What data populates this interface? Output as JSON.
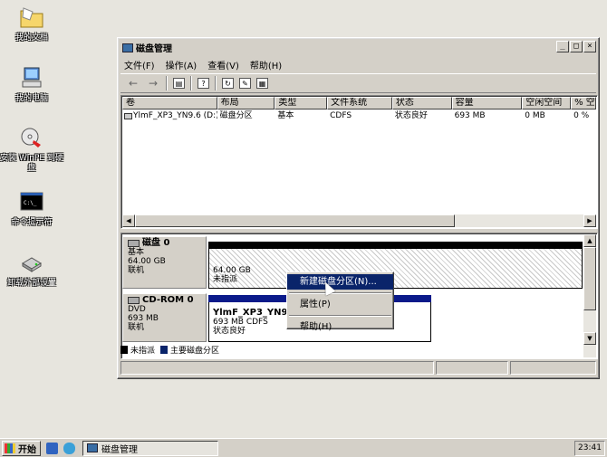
{
  "desktop": {
    "icons": [
      {
        "label": "我的文档",
        "icon": "folder-icon"
      },
      {
        "label": "我的电脑",
        "icon": "computer-icon"
      },
      {
        "label": "安装 WinPE 到硬盘",
        "icon": "install-disc-icon"
      },
      {
        "label": "命令提示符",
        "icon": "cmd-icon"
      },
      {
        "label": "卸载外部设置",
        "icon": "drive-icon"
      }
    ]
  },
  "window": {
    "title": "磁盘管理",
    "buttons": {
      "minimize": "_",
      "maximize": "□",
      "close": "×"
    },
    "menu": [
      "文件(F)",
      "操作(A)",
      "查看(V)",
      "帮助(H)"
    ],
    "toolbar": {
      "back": "←",
      "forward": "→",
      "t1": "▤",
      "t2": "?",
      "t3": "↻",
      "t4": "✎",
      "t5": "▦"
    }
  },
  "volume_list": {
    "columns": [
      "卷",
      "布局",
      "类型",
      "文件系统",
      "状态",
      "容量",
      "空闲空间",
      "% 空"
    ],
    "rows": [
      {
        "volume": "YlmF_XP3_YN9.6 (D:)",
        "layout": "磁盘分区",
        "type": "基本",
        "fs": "CDFS",
        "status": "状态良好",
        "capacity": "693 MB",
        "free": "0 MB",
        "pct": "0 %"
      }
    ]
  },
  "disks": [
    {
      "name": "磁盘 0",
      "type": "基本",
      "size": "64.00 GB",
      "state": "联机",
      "partition": {
        "size": "64.00 GB",
        "label": "未指派"
      }
    },
    {
      "name": "CD-ROM 0",
      "type": "DVD",
      "size": "693 MB",
      "state": "联机",
      "partition": {
        "name": "YlmF_XP3_YN9.6",
        "detail": "693 MB CDFS",
        "status": "状态良好"
      }
    }
  ],
  "legend": {
    "unallocated": "未指派",
    "primary": "主要磁盘分区"
  },
  "context_menu": {
    "items": [
      "新建磁盘分区(N)...",
      "属性(P)",
      "帮助(H)"
    ]
  },
  "taskbar": {
    "start": "开始",
    "task": "磁盘管理",
    "clock": "23:41"
  },
  "colors": {
    "titlebar_active": "#0a246a",
    "primary_partition": "#0a246a",
    "unallocated": "#000000",
    "cdrom_bar": "#0a1a8a"
  }
}
